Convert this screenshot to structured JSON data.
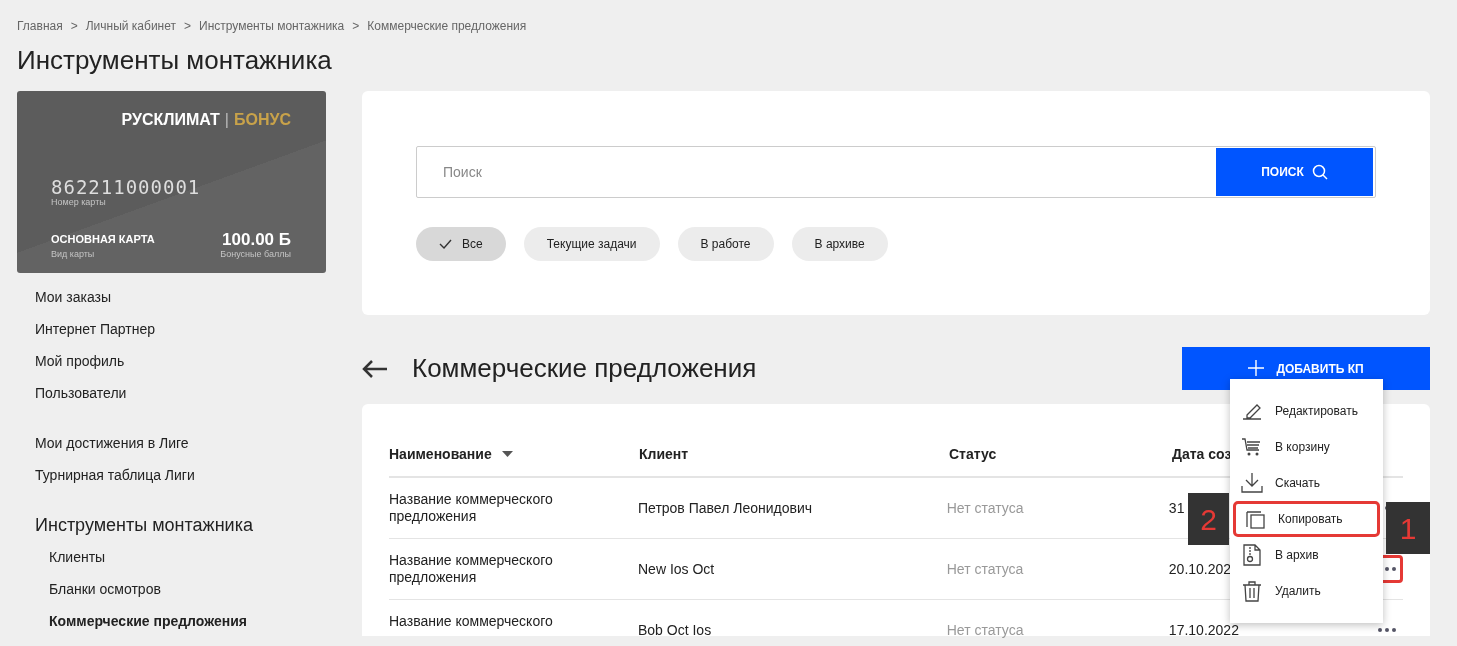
{
  "breadcrumbs": [
    "Главная",
    "Личный кабинет",
    "Инструменты монтажника",
    "Коммерческие предложения"
  ],
  "breadcrumb_separators": [
    ">",
    ">",
    ">"
  ],
  "page_title": "Инструменты монтажника",
  "card": {
    "brand": "РУСКЛИМАТ",
    "brand_divider": "|",
    "brand_accent": "БОНУС",
    "number": "862211000001",
    "number_label": "Номер карты",
    "type": "ОСНОВНАЯ КАРТА",
    "type_label": "Вид карты",
    "balance": "100.00 Б",
    "balance_label": "Бонусные баллы"
  },
  "sidebar": [
    {
      "items": [
        {
          "label": "Мои заказы",
          "selected": false
        },
        {
          "label": "Интернет Партнер",
          "selected": false
        },
        {
          "label": "Мой профиль",
          "selected": false
        },
        {
          "label": "Пользователи",
          "selected": false
        }
      ]
    },
    {
      "items": [
        {
          "label": "Мои достижения в Лиге",
          "selected": false
        },
        {
          "label": "Турнирная таблица Лиги",
          "selected": false
        }
      ]
    },
    {
      "title": "Инструменты монтажника",
      "items": [
        {
          "label": "Клиенты",
          "selected": false
        },
        {
          "label": "Бланки осмотров",
          "selected": false
        },
        {
          "label": "Коммерческие предложения",
          "selected": true
        }
      ]
    }
  ],
  "search": {
    "placeholder": "Поиск",
    "button": "ПОИСК"
  },
  "filters": [
    {
      "label": "Все",
      "selected": true
    },
    {
      "label": "Текущие задачи",
      "selected": false
    },
    {
      "label": "В работе",
      "selected": false
    },
    {
      "label": "В архиве",
      "selected": false
    }
  ],
  "section_title": "Коммерческие предложения",
  "add_button": "ДОБАВИТЬ КП",
  "table": {
    "columns": [
      {
        "label": "Наименование",
        "sorted": true
      },
      {
        "label": "Клиент",
        "sorted": false
      },
      {
        "label": "Статус",
        "sorted": false
      },
      {
        "label": "Дата соз",
        "sorted": false
      }
    ],
    "rows": [
      {
        "name": "Название коммерческого предложения",
        "client": "Петров Павел Леонидович",
        "status": "Нет статуса",
        "date": "31",
        "marked": false
      },
      {
        "name": "Название коммерческого предложения",
        "client": "New Ios Oct",
        "status": "Нет статуса",
        "date": "20.10.202",
        "marked": true
      },
      {
        "name": "Название коммерческого",
        "client": "Bob Oct Ios",
        "status": "Нет статуса",
        "date": "17.10.2022",
        "marked": false
      }
    ]
  },
  "context_menu": [
    {
      "kind": "edit",
      "label": "Редактировать",
      "marked": false
    },
    {
      "kind": "cart",
      "label": "В корзину",
      "marked": false
    },
    {
      "kind": "download",
      "label": "Скачать",
      "marked": false
    },
    {
      "kind": "copy",
      "label": "Копировать",
      "marked": true
    },
    {
      "kind": "archive",
      "label": "В архив",
      "marked": false
    },
    {
      "kind": "delete",
      "label": "Удалить",
      "marked": false
    }
  ],
  "callouts": [
    "1",
    "2"
  ]
}
